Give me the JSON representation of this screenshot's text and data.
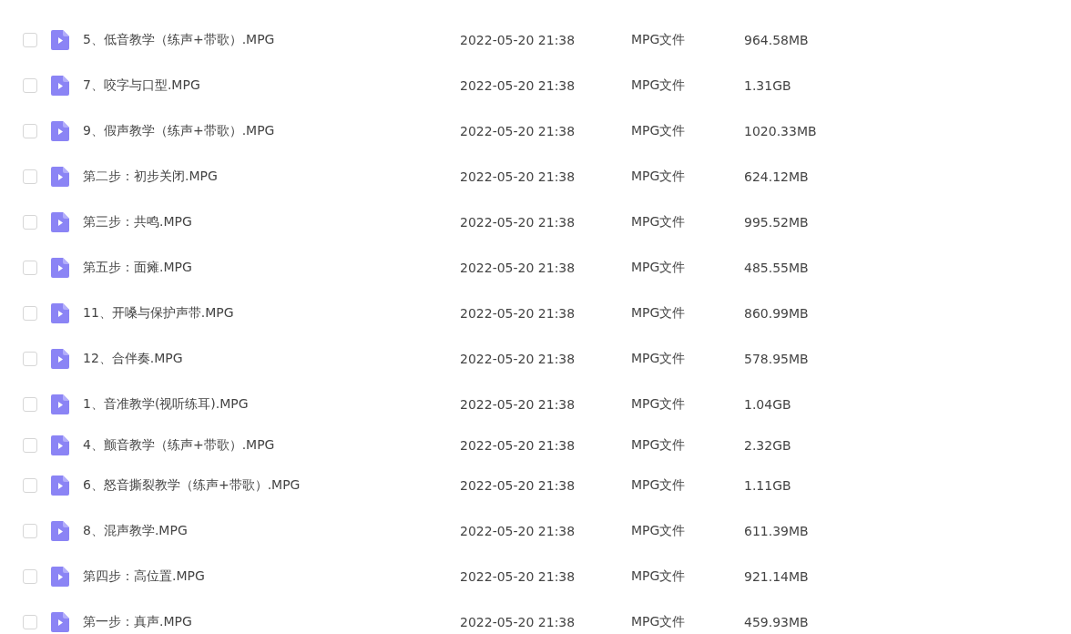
{
  "files": [
    {
      "name": "5、低音教学（练声+带歌）.MPG",
      "modified": "2022-05-20 21:38",
      "type": "MPG文件",
      "size": "964.58MB",
      "checked": false
    },
    {
      "name": "7、咬字与口型.MPG",
      "modified": "2022-05-20 21:38",
      "type": "MPG文件",
      "size": "1.31GB",
      "checked": false
    },
    {
      "name": "9、假声教学（练声+带歌）.MPG",
      "modified": "2022-05-20 21:38",
      "type": "MPG文件",
      "size": "1020.33MB",
      "checked": false
    },
    {
      "name": "第二步：初步关闭.MPG",
      "modified": "2022-05-20 21:38",
      "type": "MPG文件",
      "size": "624.12MB",
      "checked": false
    },
    {
      "name": "第三步：共鸣.MPG",
      "modified": "2022-05-20 21:38",
      "type": "MPG文件",
      "size": "995.52MB",
      "checked": false
    },
    {
      "name": "第五步：面瘫.MPG",
      "modified": "2022-05-20 21:38",
      "type": "MPG文件",
      "size": "485.55MB",
      "checked": false
    },
    {
      "name": "11、开嗓与保护声带.MPG",
      "modified": "2022-05-20 21:38",
      "type": "MPG文件",
      "size": "860.99MB",
      "checked": false
    },
    {
      "name": "12、合伴奏.MPG",
      "modified": "2022-05-20 21:38",
      "type": "MPG文件",
      "size": "578.95MB",
      "checked": false
    },
    {
      "name": "1、音准教学(视听练耳).MPG",
      "modified": "2022-05-20 21:38",
      "type": "MPG文件",
      "size": "1.04GB",
      "checked": false
    },
    {
      "name": "4、颤音教学（练声+带歌）.MPG",
      "modified": "2022-05-20 21:38",
      "type": "MPG文件",
      "size": "2.32GB",
      "checked": false
    },
    {
      "name": "6、怒音撕裂教学（练声+带歌）.MPG",
      "modified": "2022-05-20 21:38",
      "type": "MPG文件",
      "size": "1.11GB",
      "checked": false
    },
    {
      "name": "8、混声教学.MPG",
      "modified": "2022-05-20 21:38",
      "type": "MPG文件",
      "size": "611.39MB",
      "checked": false
    },
    {
      "name": "第四步：高位置.MPG",
      "modified": "2022-05-20 21:38",
      "type": "MPG文件",
      "size": "921.14MB",
      "checked": false
    },
    {
      "name": "第一步：真声.MPG",
      "modified": "2022-05-20 21:38",
      "type": "MPG文件",
      "size": "459.93MB",
      "checked": false
    }
  ]
}
